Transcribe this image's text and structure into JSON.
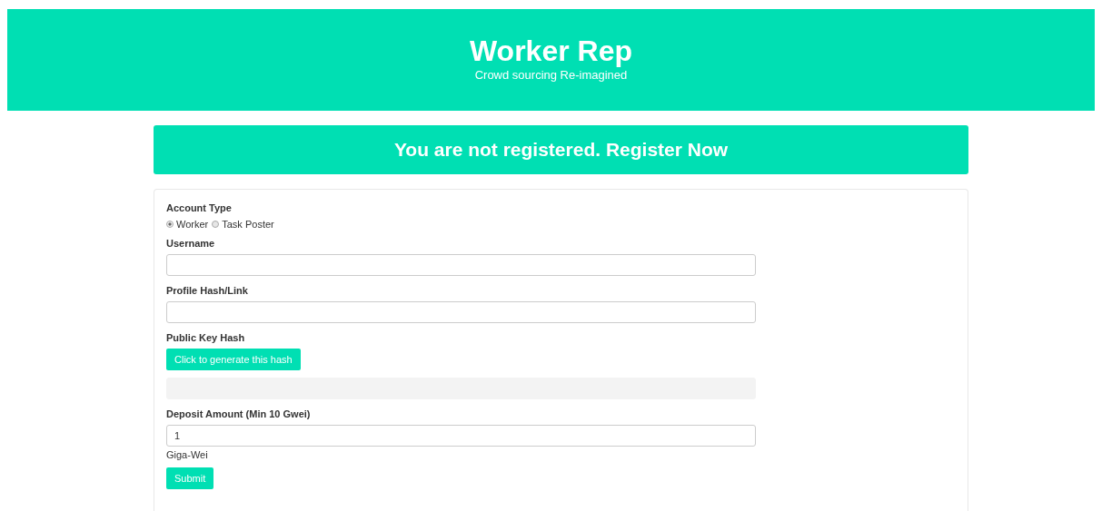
{
  "header": {
    "title": "Worker Rep",
    "subtitle": "Crowd sourcing Re-imagined"
  },
  "banner": {
    "text": "You are not registered. Register Now"
  },
  "form": {
    "account_type": {
      "label": "Account Type",
      "options": [
        {
          "label": "Worker",
          "selected": true
        },
        {
          "label": "Task Poster",
          "selected": false
        }
      ]
    },
    "fields": [
      {
        "kind": "text",
        "label": "Username"
      },
      {
        "kind": "text",
        "label": "Profile Hash/Link"
      },
      {
        "kind": "generated",
        "label": "Public Key Hash",
        "button": "Click to generate this hash",
        "disabled": true
      },
      {
        "kind": "text",
        "label": "Deposit Amount (Min 10 Gwei)",
        "value": "1",
        "help": "Giga-Wei"
      }
    ],
    "submit": "Submit"
  }
}
